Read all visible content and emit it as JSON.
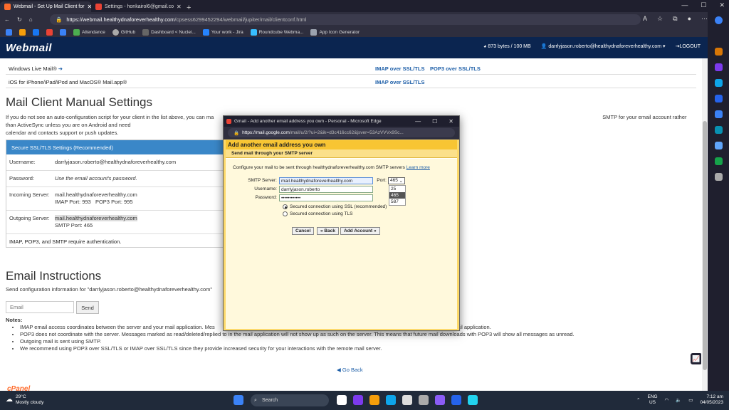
{
  "browser": {
    "tabs": [
      {
        "title": "Webmail - Set Up Mail Client for",
        "active": true
      },
      {
        "title": "Settings - honkairol6@gmail.co",
        "active": false
      }
    ],
    "url_host": "https://webmail.healthydnaforeverhealthy.com",
    "url_path": "/cpsess6299452294/webmail/jupiter/mail/clientconf.html",
    "bookmarks": [
      "Attendance",
      "GitHub",
      "Dashboard < Nuclei...",
      "Your work - Jira",
      "Roundcube Webma...",
      "App Icon Generator"
    ]
  },
  "header": {
    "logo": "Webmail",
    "quota": "873 bytes / 100 MB",
    "account": "darrlyjason.roberto@healthydnaforeverhealthy.com",
    "logout": "LOGOUT"
  },
  "clients": [
    {
      "name": "Windows Live Mail®",
      "imap": "IMAP over SSL/TLS",
      "pop3": "POP3 over SSL/TLS"
    },
    {
      "name": "iOS for iPhone/iPad/iPod and MacOS® Mail.app®",
      "imap": "IMAP over SSL/TLS",
      "pop3": ""
    }
  ],
  "manual": {
    "title": "Mail Client Manual Settings",
    "intro_a": "If you do not see an auto-configuration script for your client in the list above, you can ma",
    "intro_b": "SMTP for your email account rather than ActiveSync unless you are on Android and need",
    "intro_c": "calendar and contacts support or push updates.",
    "box_title": "Secure SSL/TLS Settings (Recommended)",
    "username_label": "Username:",
    "username": "darrlyjason.roberto@healthydnaforeverhealthy.com",
    "password_label": "Password:",
    "password": "Use the email account's password.",
    "incoming_label": "Incoming Server:",
    "incoming_host": "mail.healthydnaforeverhealthy.com",
    "incoming_ports": "IMAP Port: 993   POP3 Port: 995",
    "outgoing_label": "Outgoing Server:",
    "outgoing_host": "mail.healthydnaforeverhealthy.com",
    "outgoing_port": "SMTP Port: 465",
    "auth_note": "IMAP, POP3, and SMTP require authentication."
  },
  "instructions": {
    "title": "Email Instructions",
    "desc": "Send configuration information for \"darrlyjason.roberto@healthydnaforeverhealthy.com\"",
    "email_placeholder": "Email",
    "send": "Send",
    "notes_label": "Notes:",
    "notes": [
      "IMAP email access coordinates between the server and your mail application. Mes",
      "POP3 does not coordinate with the server. Messages marked as read/deleted/replied to in the mail application will not show up as such on the server. This means that future mail downloads with POP3 will show all messages as unread.",
      "Outgoing mail is sent using SMTP.",
      "We recommend using POP3 over SSL/TLS or IMAP over SSL/TLS since they provide increased security for your interactions with the remote mail server."
    ],
    "note1_tail": "e mail application.",
    "go_back": "Go Back"
  },
  "footer_logo": "cPanel",
  "popup": {
    "window_title": "Gmail - Add another email address you own - Personal - Microsoft Edge",
    "url_host": "https://mail.google.com",
    "url_path": "/mail/u/2/?ui=2&ik=d3c416cc62&jsver=53AzVVVx9Sc...",
    "heading": "Add another email address you own",
    "subheading": "Send mail through your SMTP server",
    "desc": "Configure your mail to be sent through healthydnaforeverhealthy.com SMTP servers",
    "learn_more": "Learn more",
    "smtp_label": "SMTP Server:",
    "smtp_value": "mail.healthydnaforeverhealthy.com",
    "port_label": "Port:",
    "port_value": "465",
    "port_options": [
      "25",
      "465",
      "587"
    ],
    "username_label": "Username:",
    "username_value": "darrlyjason.roberto",
    "password_label": "Password:",
    "password_value": "••••••••••••",
    "ssl_option": "Secured connection using SSL (recommended)",
    "tls_option": "Secured connection using TLS",
    "cancel": "Cancel",
    "back": "« Back",
    "add": "Add Account »"
  },
  "taskbar": {
    "temp": "29°C",
    "weather": "Mostly cloudy",
    "search": "Search",
    "lang1": "ENG",
    "lang2": "US",
    "time": "7:12 am",
    "date": "04/05/2023"
  }
}
